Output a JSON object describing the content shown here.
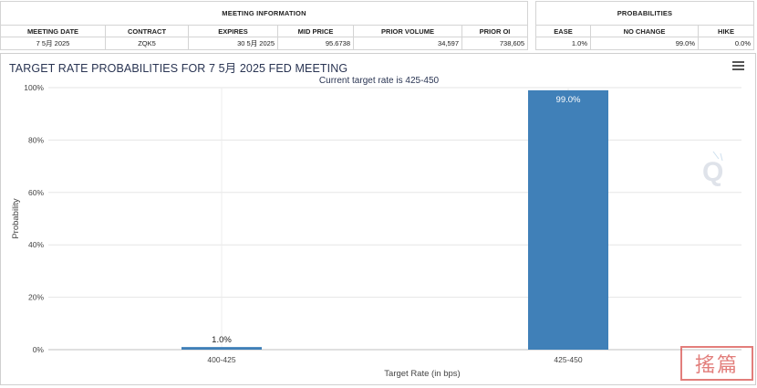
{
  "meeting_info": {
    "title": "MEETING INFORMATION",
    "columns": [
      "MEETING DATE",
      "CONTRACT",
      "EXPIRES",
      "MID PRICE",
      "PRIOR VOLUME",
      "PRIOR OI"
    ],
    "row": [
      "7 5月 2025",
      "ZQK5",
      "30 5月 2025",
      "95.6738",
      "34,597",
      "738,605"
    ]
  },
  "probabilities": {
    "title": "PROBABILITIES",
    "columns": [
      "EASE",
      "NO CHANGE",
      "HIKE"
    ],
    "row": [
      "1.0%",
      "99.0%",
      "0.0%"
    ]
  },
  "panel": {
    "title": "TARGET RATE PROBABILITIES FOR 7 5月 2025 FED MEETING"
  },
  "chart_data": {
    "type": "bar",
    "title": "TARGET RATE PROBABILITIES FOR 7 5月 2025 FED MEETING",
    "subtitle": "Current target rate is 425-450",
    "xlabel": "Target Rate (in bps)",
    "ylabel": "Probability",
    "categories": [
      "400-425",
      "425-450"
    ],
    "values": [
      1.0,
      99.0
    ],
    "data_labels": [
      "1.0%",
      "99.0%"
    ],
    "ylim": [
      0,
      100
    ],
    "yticks": [
      0,
      20,
      40,
      60,
      80,
      100
    ],
    "ytick_labels": [
      "0%",
      "20%",
      "40%",
      "60%",
      "80%",
      "100%"
    ],
    "grid": true,
    "bar_color": "#4080b8"
  },
  "stamp_text": "搖篇"
}
